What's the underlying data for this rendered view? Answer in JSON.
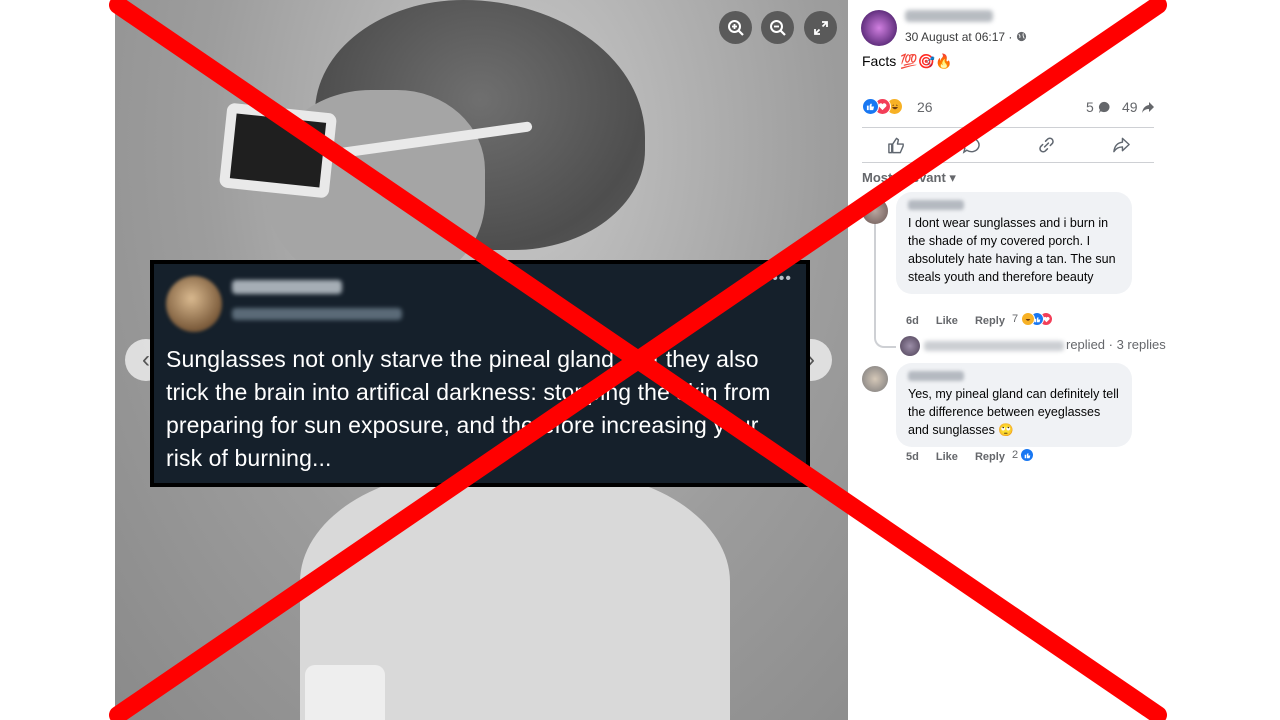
{
  "viewer": {
    "controls": {
      "zoom_in_icon": "zoom-in",
      "zoom_out_icon": "zoom-out",
      "fullscreen_icon": "expand"
    },
    "nav": {
      "prev_glyph": "‹",
      "next_glyph": "›"
    },
    "tweet": {
      "more_glyph": "•••",
      "text": "Sunglasses not only starve the pineal gland, but they also trick the brain into artifical darkness: stopping the skin from preparing for sun exposure, and therefore increasing your risk of burning..."
    }
  },
  "post": {
    "date": "30 August at 06:17 · ",
    "privacy_icon": "globe-icon",
    "text": "Facts 💯🎯🔥",
    "reactions": {
      "count": "26",
      "types": [
        "like",
        "love",
        "haha"
      ]
    },
    "comments_count": "5",
    "shares_count": "49",
    "actions": [
      "like",
      "comment",
      "copy-link",
      "share"
    ],
    "sort_label": "Most relevant ▾"
  },
  "comments": [
    {
      "text": "I dont wear sunglasses and i burn in the shade of my covered porch. I absolutely hate having a tan. The sun steals youth and therefore beauty",
      "age": "6d",
      "like_label": "Like",
      "reply_label": "Reply",
      "reaction_count": "7",
      "replies_label": "replied · 3 replies"
    },
    {
      "text": "Yes, my pineal gland can definitely tell the difference between eyeglasses and sunglasses 🙄",
      "age": "5d",
      "like_label": "Like",
      "reply_label": "Reply",
      "reaction_count": "2"
    }
  ],
  "overlay": {
    "type": "red-x",
    "color": "#ff0000"
  },
  "colors": {
    "tweet_bg": "#15202b",
    "like_blue": "#1877f2",
    "love_red": "#f33e58",
    "haha_yellow": "#f7b125"
  }
}
